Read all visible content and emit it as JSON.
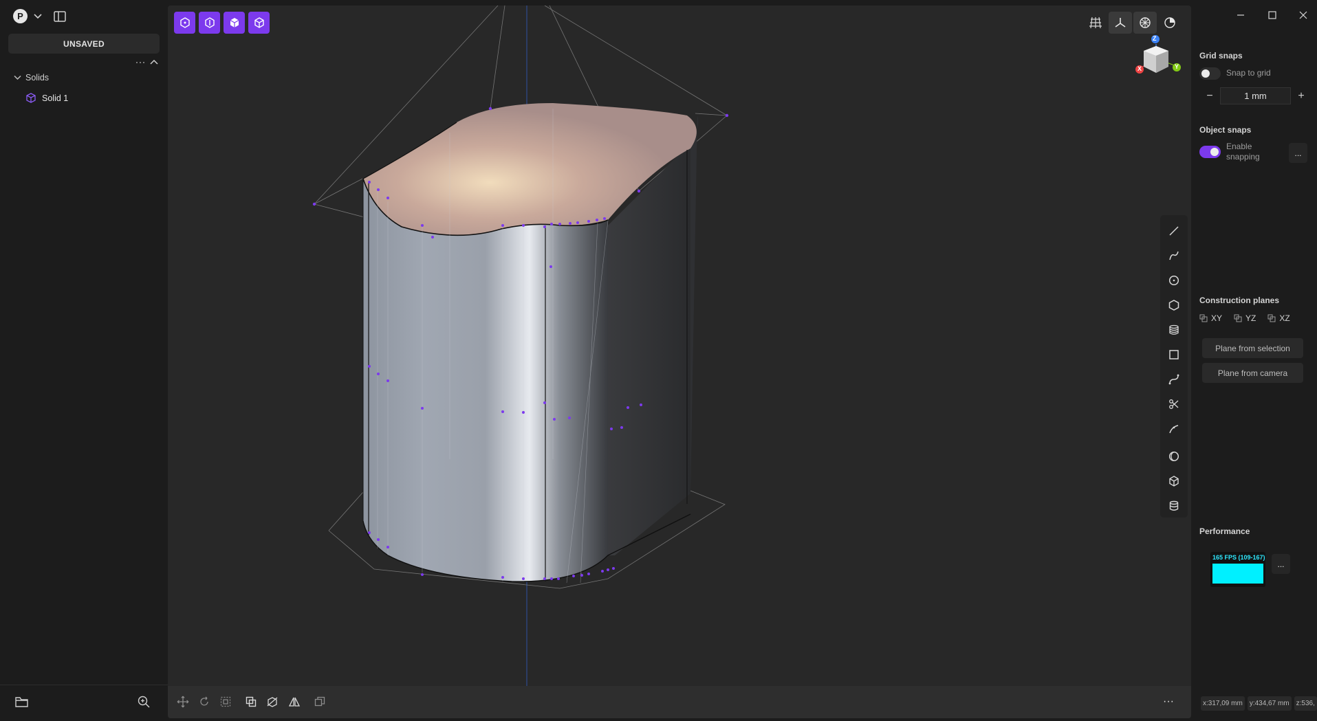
{
  "left_panel": {
    "avatar_letter": "P",
    "file_status": "UNSAVED",
    "tree_section": "Solids",
    "tree_items": [
      {
        "label": "Solid 1"
      }
    ]
  },
  "viewport": {
    "top_tools": [
      "box-select-icon",
      "face-select-icon",
      "solid-select-icon",
      "body-select-icon"
    ],
    "view_toggles": [
      "grid-icon",
      "axes-icon",
      "wireframe-icon",
      "shading-icon"
    ],
    "nav_cube": {
      "x_label": "X",
      "y_label": "Y",
      "z_label": "Z"
    },
    "right_tools": [
      "line-icon",
      "curve-icon",
      "circle-icon",
      "polygon-icon",
      "layers-icon",
      "rectangle-icon",
      "spline-icon",
      "scissors-icon",
      "extend-icon",
      "shell-icon",
      "cube-icon",
      "cylinder-icon"
    ],
    "bottom_tools": [
      "move-icon",
      "rotate-icon",
      "scale-icon",
      "boolean-icon",
      "cut-icon",
      "mirror-icon",
      "duplicate-icon"
    ],
    "bottom_more": "···"
  },
  "right_panel": {
    "grid_snaps": {
      "title": "Grid snaps",
      "snap_label": "Snap to grid",
      "snap_on": false,
      "step_value": "1 mm",
      "minus": "−",
      "plus": "+"
    },
    "object_snaps": {
      "title": "Object snaps",
      "enable_label_1": "Enable",
      "enable_label_2": "snapping",
      "enabled": true,
      "more": "..."
    },
    "construction_planes": {
      "title": "Construction planes",
      "axes": [
        "XY",
        "YZ",
        "XZ"
      ],
      "from_selection": "Plane from selection",
      "from_camera": "Plane from camera"
    },
    "performance": {
      "title": "Performance",
      "fps_text": "165 FPS (109-167)",
      "more": "..."
    },
    "coords": [
      "x:317,09 mm",
      "y:434,67 mm",
      "z:536,"
    ]
  },
  "colors": {
    "accent": "#7c3aed",
    "viewport_bg": "#282828",
    "panel_bg": "#1c1c1c",
    "fps_cyan": "#00f0ff"
  }
}
